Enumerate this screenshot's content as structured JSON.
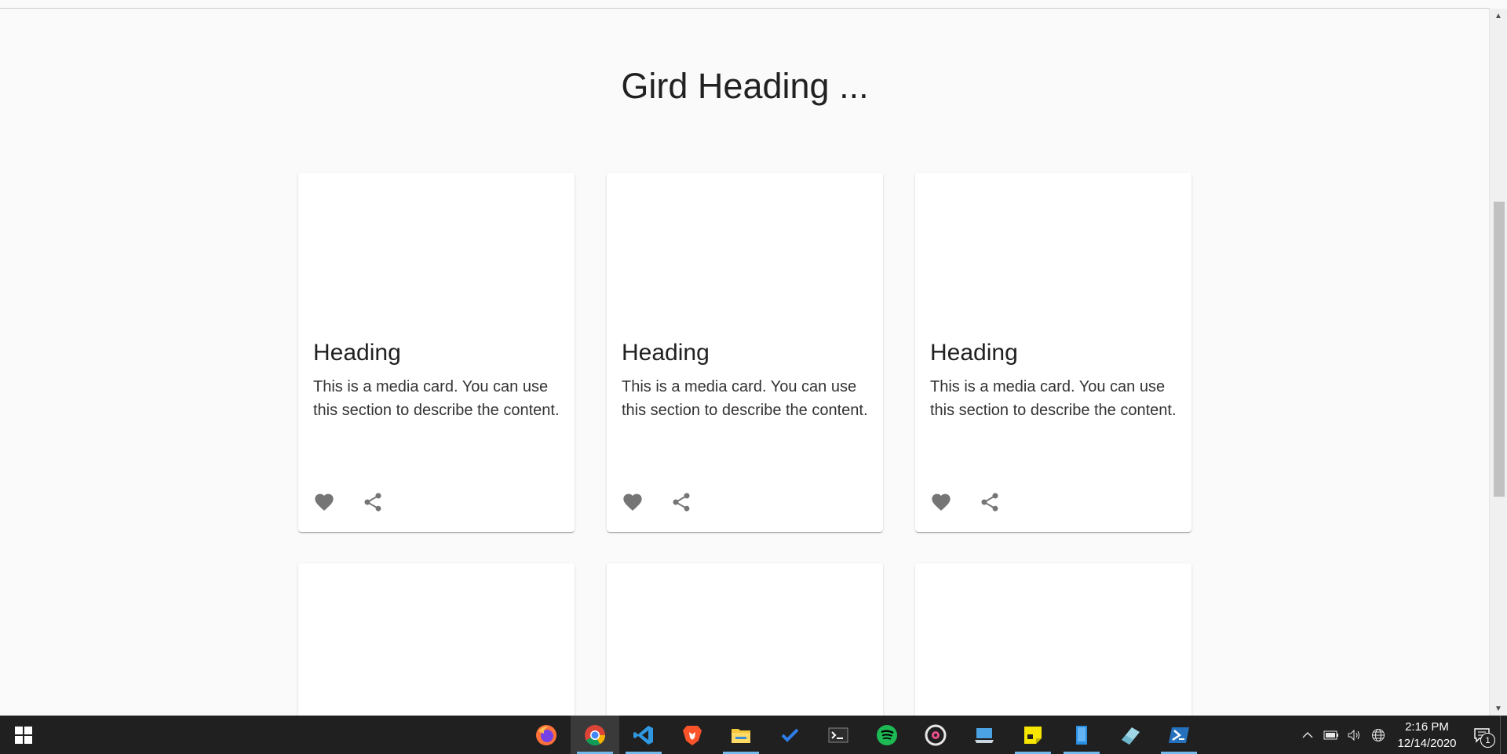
{
  "page": {
    "heading": "Gird Heading ..."
  },
  "cards": [
    {
      "title": "Heading",
      "description": "This is a media card. You can use this section to describe the content."
    },
    {
      "title": "Heading",
      "description": "This is a media card. You can use this section to describe the content."
    },
    {
      "title": "Heading",
      "description": "This is a media card. You can use this section to describe the content."
    }
  ],
  "card_icons": {
    "like": "heart-icon",
    "share": "share-icon"
  },
  "taskbar": {
    "apps": [
      "firefox",
      "chrome",
      "vscode",
      "brave",
      "file-explorer",
      "todo",
      "terminal",
      "spotify",
      "music-player",
      "remote-desktop",
      "sticky-notes",
      "notepad",
      "eraser-app",
      "powershell"
    ],
    "time": "2:16 PM",
    "date": "12/14/2020",
    "notification_count": "1"
  },
  "colors": {
    "background": "#fafafa",
    "card": "#ffffff",
    "icon": "#757575",
    "taskbar": "#202020",
    "accent": "#76b9ed"
  }
}
